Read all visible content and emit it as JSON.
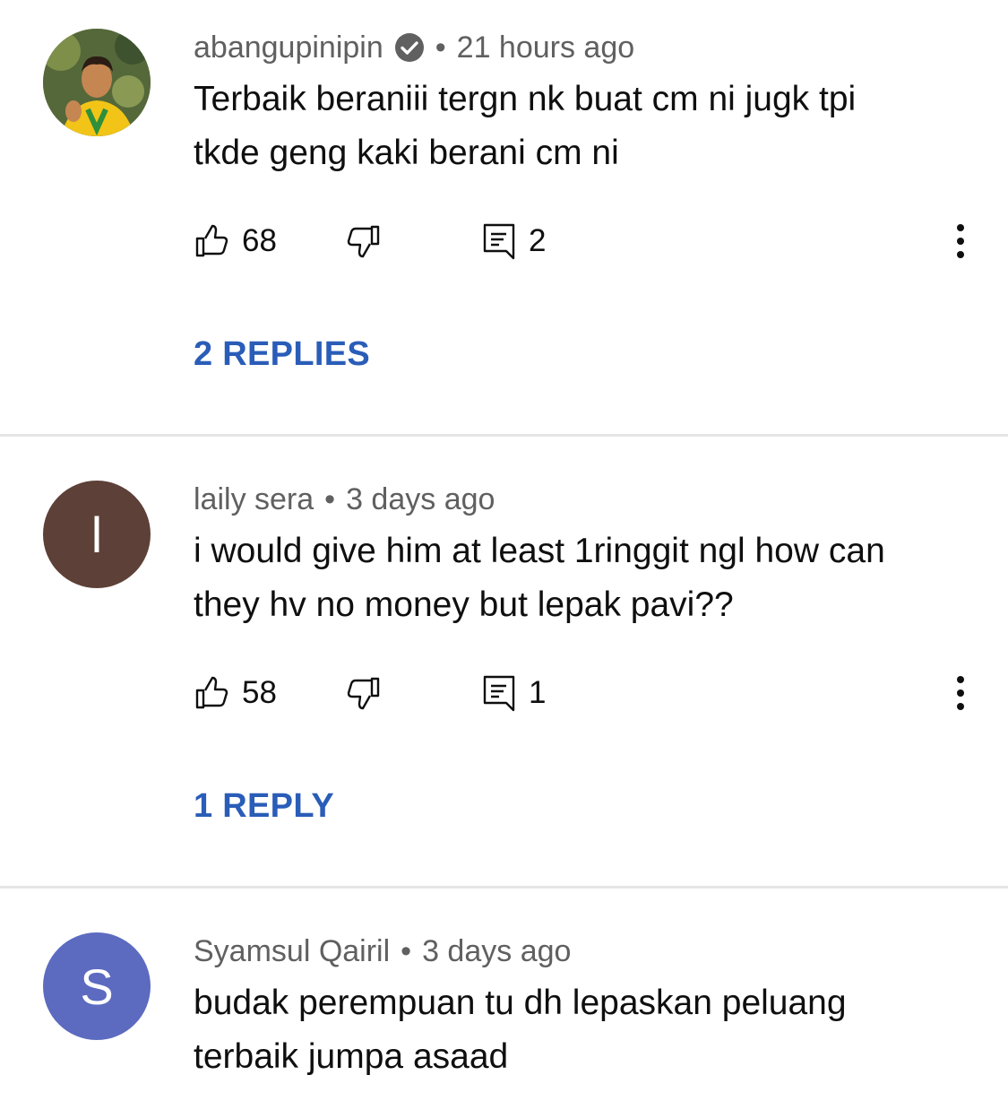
{
  "comments": [
    {
      "author": "abangupinipin",
      "verified": true,
      "time": "21 hours ago",
      "text_lines": [
        "Terbaik beraniii tergn nk buat cm ni jugk tpi",
        "tkde geng kaki berani cm ni"
      ],
      "likes": "68",
      "reply_count": "2",
      "replies_label": "2 REPLIES",
      "avatar_kind": "photo"
    },
    {
      "author": "laily sera",
      "verified": false,
      "time": "3 days ago",
      "text_lines": [
        "i would give him at least 1ringgit ngl how can",
        "they hv no money but lepak pavi??"
      ],
      "likes": "58",
      "reply_count": "1",
      "replies_label": "1 REPLY",
      "avatar_letter": "l",
      "avatar_color": "#5d4037"
    },
    {
      "author": "Syamsul Qairil",
      "verified": false,
      "time": "3 days ago",
      "text_lines": [
        "budak perempuan tu dh lepaskan peluang",
        "terbaik jumpa asaad"
      ],
      "avatar_letter": "S",
      "avatar_color": "#5c6bc0"
    }
  ],
  "separator": "•",
  "colors": {
    "link": "#2a5db8",
    "meta": "#606060",
    "divider": "#e5e5e5"
  }
}
